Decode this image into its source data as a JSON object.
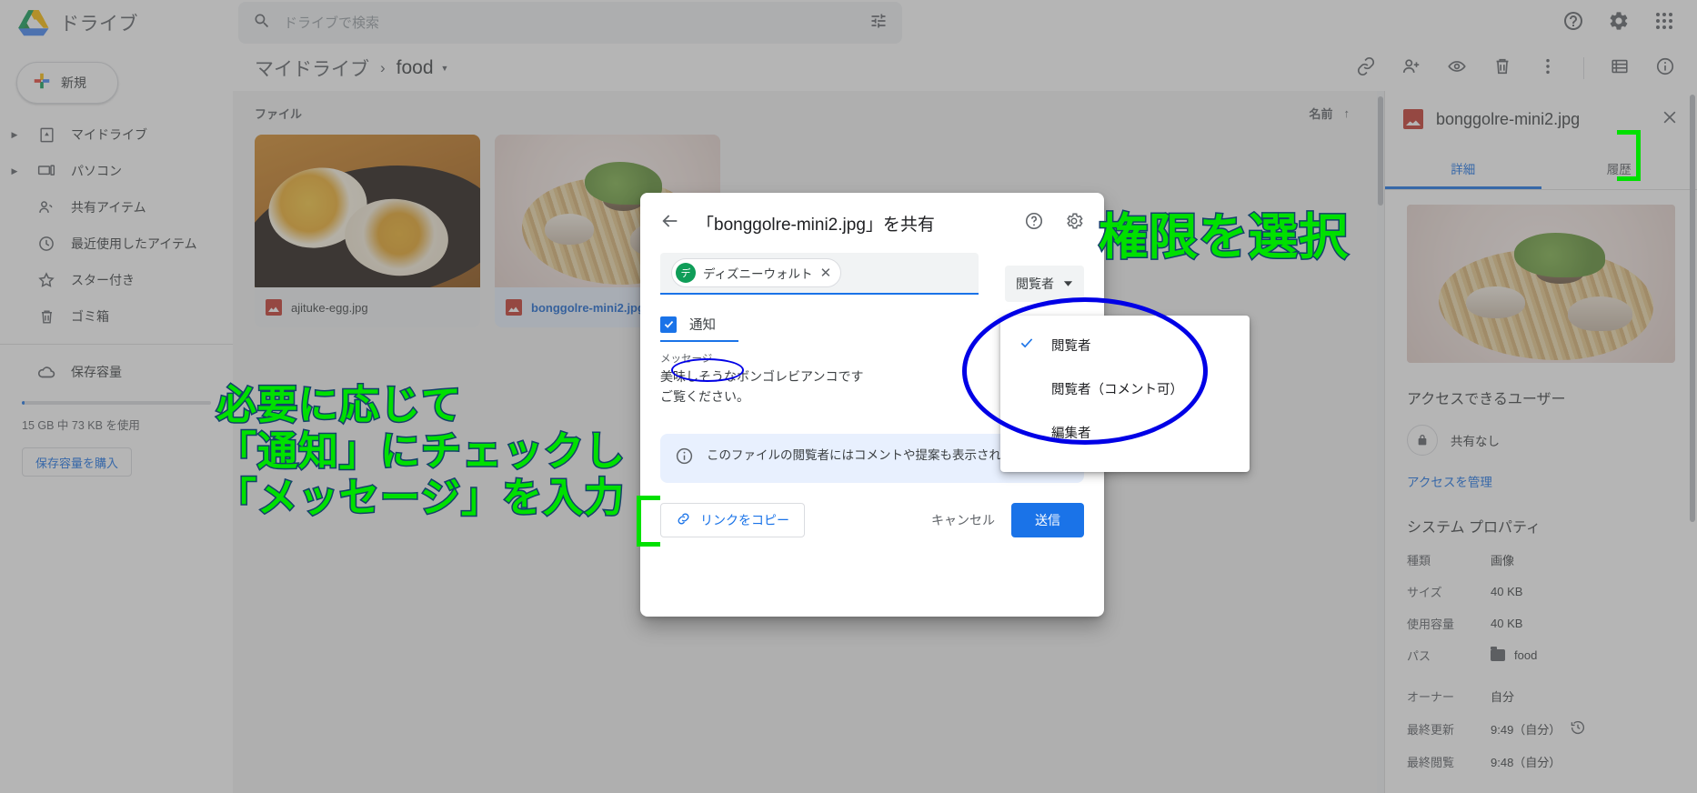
{
  "topbar": {
    "brand": "ドライブ",
    "search_placeholder": "ドライブで検索",
    "search_value": "",
    "icons": {
      "search": "search-icon",
      "tune": "tune-icon",
      "help": "help-icon",
      "settings": "gear-icon",
      "apps": "apps-grid-icon"
    }
  },
  "sidebar": {
    "new_button": "新規",
    "items": [
      {
        "label": "マイドライブ",
        "icon": "my-drive-icon",
        "expandable": true
      },
      {
        "label": "パソコン",
        "icon": "computer-icon",
        "expandable": true
      },
      {
        "label": "共有アイテム",
        "icon": "people-icon",
        "expandable": false
      },
      {
        "label": "最近使用したアイテム",
        "icon": "clock-icon",
        "expandable": false
      },
      {
        "label": "スター付き",
        "icon": "star-icon",
        "expandable": false
      },
      {
        "label": "ゴミ箱",
        "icon": "trash-icon",
        "expandable": false
      },
      {
        "label": "保存容量",
        "icon": "cloud-icon",
        "expandable": false
      }
    ],
    "storage_text": "15 GB 中 73 KB を使用",
    "buy_button": "保存容量を購入"
  },
  "breadcrumb": {
    "root": "マイドライブ",
    "separator": "›",
    "current": "food",
    "actions": [
      "link-icon",
      "add-person-icon",
      "eye-icon",
      "trash-icon",
      "more-vert-icon",
      "list-view-icon",
      "info-icon"
    ]
  },
  "main": {
    "section_title": "ファイル",
    "sort_label": "名前",
    "sort_direction": "↑",
    "files": [
      {
        "name": "ajituke-egg.jpg",
        "selected": false,
        "thumb": "egg"
      },
      {
        "name": "bonggolre-mini2.jpg",
        "selected": true,
        "thumb": "pasta"
      }
    ]
  },
  "details": {
    "file_name": "bonggolre-mini2.jpg",
    "tabs": [
      {
        "label": "詳細",
        "active": true
      },
      {
        "label": "履歴",
        "active": false
      }
    ],
    "access_title": "アクセスできるユーザー",
    "access_status": "共有なし",
    "manage_access": "アクセスを管理",
    "system_title": "システム プロパティ",
    "properties": [
      {
        "key": "種類",
        "value": "画像"
      },
      {
        "key": "サイズ",
        "value": "40 KB"
      },
      {
        "key": "使用容量",
        "value": "40 KB"
      },
      {
        "key": "パス",
        "value": "food"
      },
      {
        "key": "オーナー",
        "value": "自分"
      },
      {
        "key": "最終更新",
        "value": "9:49（自分）"
      },
      {
        "key": "最終閲覧",
        "value": "9:48（自分）"
      }
    ]
  },
  "dialog": {
    "title": "「bonggolre-mini2.jpg」を共有",
    "back_icon": "arrow-back-icon",
    "help_icon": "help-icon",
    "settings_icon": "gear-icon",
    "recipient": {
      "avatar_initial": "デ",
      "name": "ディズニーウォルト",
      "remove": "✕"
    },
    "role_value": "閲覧者",
    "notify_label": "通知",
    "notify_checked": true,
    "message_label": "メッセージ",
    "message_value": "美味しそうなボンゴレビアンコです\nご覧ください。",
    "info_text": "このファイルの閲覧者にはコメントや提案も表示されます",
    "copy_link": "リンクをコピー",
    "cancel": "キャンセル",
    "send": "送信"
  },
  "role_menu": {
    "items": [
      {
        "label": "閲覧者",
        "checked": true
      },
      {
        "label": "閲覧者（コメント可）",
        "checked": false
      },
      {
        "label": "編集者",
        "checked": false
      }
    ]
  },
  "annotations": {
    "permission": "権限を選択",
    "steps": "必要に応じて\n「通知」にチェックし\n「メッセージ」を入力"
  },
  "colors": {
    "accent": "#1a73e8",
    "annotation_green": "#00e000",
    "annotation_stroke": "#14416b",
    "annotation_circle": "#0000e6",
    "drive_blue": "#4285f4",
    "drive_green": "#0f9d58",
    "drive_yellow": "#fbbc04"
  }
}
